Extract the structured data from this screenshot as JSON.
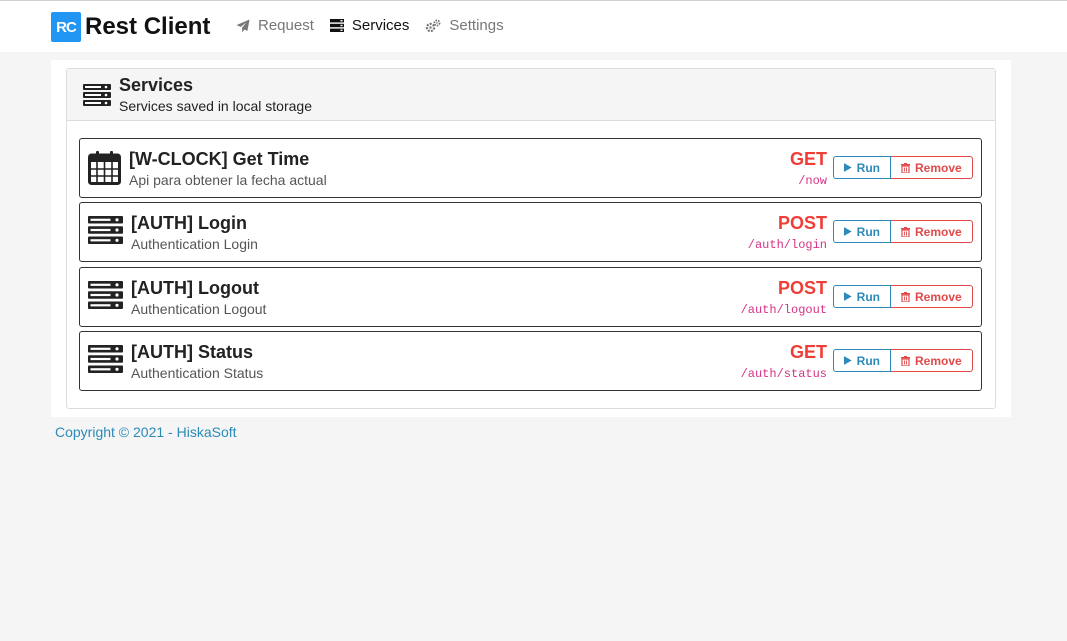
{
  "brand": {
    "logo": "RC",
    "title": "Rest Client"
  },
  "nav": [
    {
      "label": "Request",
      "icon": "paper-plane-icon",
      "active": false
    },
    {
      "label": "Services",
      "icon": "server-icon",
      "active": true
    },
    {
      "label": "Settings",
      "icon": "cogs-icon",
      "active": false
    }
  ],
  "card": {
    "title": "Services",
    "subtitle": "Services saved in local storage"
  },
  "services": [
    {
      "title": "[W-CLOCK] Get Time",
      "description": "Api para obtener la fecha actual",
      "method": "GET",
      "path": "/now",
      "icon": "calendar-icon",
      "run_label": "Run",
      "remove_label": "Remove"
    },
    {
      "title": "[AUTH] Login",
      "description": "Authentication Login",
      "method": "POST",
      "path": "/auth/login",
      "icon": "server-icon",
      "run_label": "Run",
      "remove_label": "Remove"
    },
    {
      "title": "[AUTH] Logout",
      "description": "Authentication Logout",
      "method": "POST",
      "path": "/auth/logout",
      "icon": "server-icon",
      "run_label": "Run",
      "remove_label": "Remove"
    },
    {
      "title": "[AUTH] Status",
      "description": "Authentication Status",
      "method": "GET",
      "path": "/auth/status",
      "icon": "server-icon",
      "run_label": "Run",
      "remove_label": "Remove"
    }
  ],
  "footer": {
    "text": "Copyright © 2021 - HiskaSoft"
  },
  "colors": {
    "brand": "#2196f3",
    "method": "#ef3e36",
    "path": "#d63384",
    "run": "#2b8ab8",
    "remove": "#e04a4a",
    "link": "#2b8ab8"
  }
}
